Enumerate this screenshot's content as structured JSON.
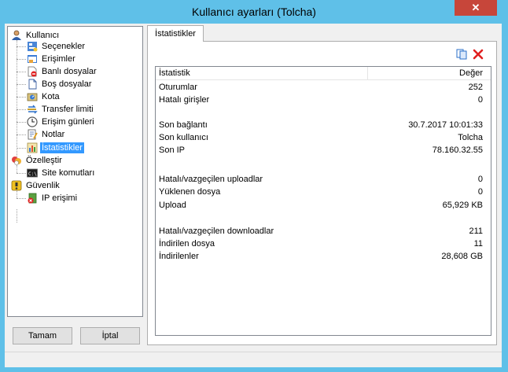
{
  "window": {
    "title": "Kullanıcı ayarları (Tolcha)",
    "close_glyph": "✕"
  },
  "tree": [
    {
      "name": "tree-item-kullanici",
      "label": "Kullanıcı",
      "icon": "user-icon"
    },
    {
      "name": "tree-item-secenekler",
      "label": "Seçenekler",
      "icon": "options-icon"
    },
    {
      "name": "tree-item-erisimler",
      "label": "Erişimler",
      "icon": "access-icon"
    },
    {
      "name": "tree-item-banli-dosyalar",
      "label": "Banlı dosyalar",
      "icon": "banned-files-icon"
    },
    {
      "name": "tree-item-bos-dosyalar",
      "label": "Boş dosyalar",
      "icon": "empty-file-icon"
    },
    {
      "name": "tree-item-kota",
      "label": "Kota",
      "icon": "quota-icon"
    },
    {
      "name": "tree-item-transfer-limiti",
      "label": "Transfer limiti",
      "icon": "transfer-limit-icon"
    },
    {
      "name": "tree-item-erisim-gunleri",
      "label": "Erişim günleri",
      "icon": "clock-icon"
    },
    {
      "name": "tree-item-notlar",
      "label": "Notlar",
      "icon": "notes-icon"
    },
    {
      "name": "tree-item-istatistikler",
      "label": "İstatistikler",
      "icon": "statistics-icon",
      "selected": true
    },
    {
      "name": "tree-item-ozellestir",
      "label": "Özelleştir",
      "icon": "customize-icon"
    },
    {
      "name": "tree-item-site-komutlari",
      "label": "Site komutları",
      "icon": "console-icon"
    },
    {
      "name": "tree-item-guvenlik",
      "label": "Güvenlik",
      "icon": "security-icon"
    },
    {
      "name": "tree-item-ip-erisimi",
      "label": "IP erişimi",
      "icon": "ip-access-icon"
    }
  ],
  "buttons": {
    "ok": "Tamam",
    "cancel": "İptal"
  },
  "tab": {
    "label": "İstatistikler"
  },
  "toolbar": {
    "copy_icon": "copy-icon",
    "delete_icon": "delete-icon"
  },
  "stats": {
    "columns": [
      "İstatistik",
      "Değer"
    ],
    "rows": [
      {
        "key": "Oturumlar",
        "value": "252"
      },
      {
        "key": "Hatalı girişler",
        "value": "0"
      },
      {
        "key": "",
        "value": ""
      },
      {
        "key": "Son bağlantı",
        "value": "30.7.2017 10:01:33"
      },
      {
        "key": "Son kullanıcı",
        "value": "Tolcha"
      },
      {
        "key": "Son IP",
        "value": "78.160.32.55"
      },
      {
        "key": "",
        "value": ""
      },
      {
        "key": "Hatalı/vazgeçilen uploadlar",
        "value": "0"
      },
      {
        "key": "Yüklenen dosya",
        "value": "0"
      },
      {
        "key": "Upload",
        "value": "65,929 KB"
      },
      {
        "key": "",
        "value": ""
      },
      {
        "key": "Hatalı/vazgeçilen downloadlar",
        "value": "211"
      },
      {
        "key": "İndirilen dosya",
        "value": "11"
      },
      {
        "key": "İndirilenler",
        "value": "28,608 GB"
      }
    ]
  },
  "colors": {
    "titlebar": "#5fc0e8",
    "selection": "#3399ff",
    "close": "#c7463a",
    "delete": "#e02020"
  }
}
